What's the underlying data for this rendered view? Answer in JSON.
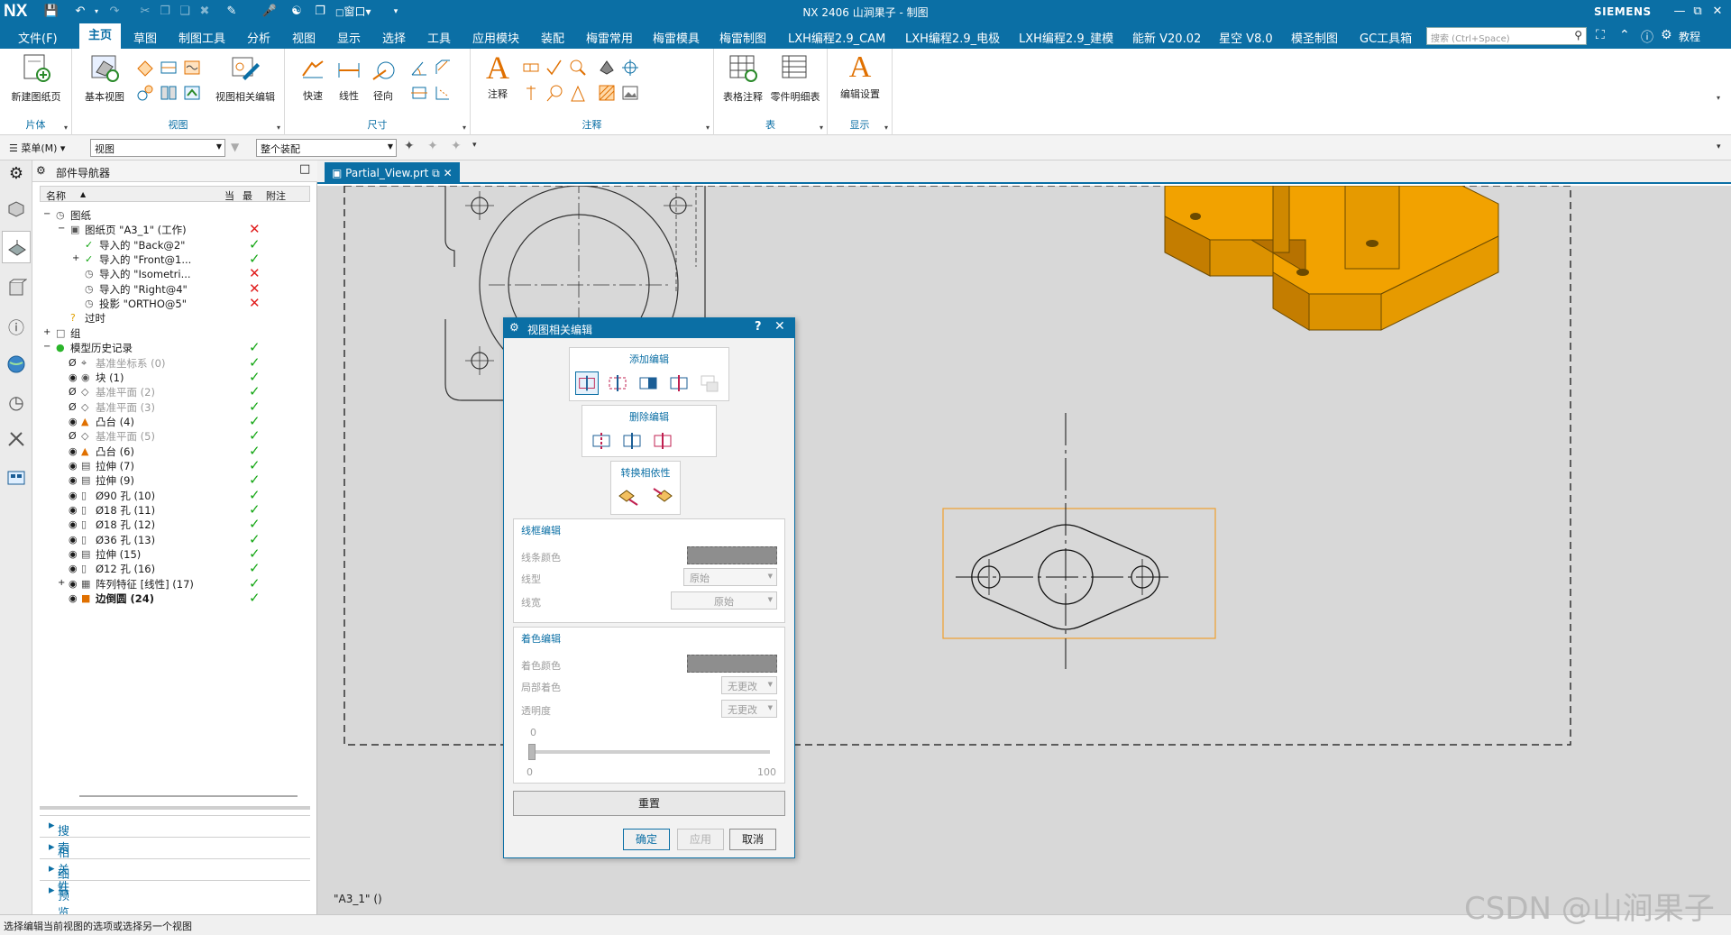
{
  "titlebar": {
    "logo": "NX",
    "title": "NX 2406 山涧果子 - 制图",
    "brand": "SIEMENS",
    "window_menu": "窗口"
  },
  "menubar": {
    "items": [
      "文件(F)",
      "主页",
      "草图",
      "制图工具",
      "分析",
      "视图",
      "显示",
      "选择",
      "工具",
      "应用模块",
      "装配",
      "梅雷常用",
      "梅雷模具",
      "梅雷制图",
      "LXH编程2.9_CAM",
      "LXH编程2.9_电极",
      "LXH编程2.9_建模",
      "能新 V20.02",
      "星空 V8.0",
      "模圣制图",
      "GC工具箱"
    ],
    "active": "主页",
    "search_placeholder": "搜索 (Ctrl+Space)",
    "tutorial": "教程"
  },
  "ribbon": {
    "groups": [
      {
        "label": "片体",
        "buttons": [
          "新建图纸页"
        ]
      },
      {
        "label": "视图",
        "buttons": [
          "基本视图",
          "视图相关编辑"
        ]
      },
      {
        "label": "尺寸",
        "buttons": [
          "快速",
          "线性",
          "径向"
        ]
      },
      {
        "label": "注释",
        "buttons": [
          "注释"
        ]
      },
      {
        "label": "表",
        "buttons": [
          "表格注释",
          "零件明细表"
        ]
      },
      {
        "label": "显示",
        "buttons": [
          "编辑设置"
        ]
      }
    ]
  },
  "cmdbar": {
    "menu": "菜单(M)",
    "filter": "视图",
    "scope": "整个装配"
  },
  "navigator": {
    "title": "部件导航器",
    "columns": [
      "名称",
      "当",
      "最",
      "附注"
    ],
    "rows": [
      {
        "label": "图纸",
        "mark": ""
      },
      {
        "label": "图纸页 \"A3_1\" (工作)",
        "mark": "x"
      },
      {
        "label": "导入的 \"Back@2\"",
        "mark": "v"
      },
      {
        "label": "导入的 \"Front@1...",
        "mark": "v"
      },
      {
        "label": "导入的 \"Isometri...",
        "mark": "x"
      },
      {
        "label": "导入的 \"Right@4\"",
        "mark": "x"
      },
      {
        "label": "投影 \"ORTHO@5\"",
        "mark": "x"
      },
      {
        "label": "过时",
        "mark": ""
      },
      {
        "label": "组",
        "mark": ""
      },
      {
        "label": "模型历史记录",
        "mark": "v"
      },
      {
        "label": "基准坐标系 (0)",
        "mark": "v"
      },
      {
        "label": "块 (1)",
        "mark": "v"
      },
      {
        "label": "基准平面 (2)",
        "mark": "v"
      },
      {
        "label": "基准平面 (3)",
        "mark": "v"
      },
      {
        "label": "凸台 (4)",
        "mark": "v"
      },
      {
        "label": "基准平面 (5)",
        "mark": "v"
      },
      {
        "label": "凸台 (6)",
        "mark": "v"
      },
      {
        "label": "拉伸 (7)",
        "mark": "v"
      },
      {
        "label": "拉伸 (9)",
        "mark": "v"
      },
      {
        "label": "Ø90 孔 (10)",
        "mark": "v"
      },
      {
        "label": "Ø18 孔 (11)",
        "mark": "v"
      },
      {
        "label": "Ø18 孔 (12)",
        "mark": "v"
      },
      {
        "label": "Ø36 孔 (13)",
        "mark": "v"
      },
      {
        "label": "拉伸 (15)",
        "mark": "v"
      },
      {
        "label": "Ø12 孔 (16)",
        "mark": "v"
      },
      {
        "label": "阵列特征 [线性] (17)",
        "mark": "v"
      },
      {
        "label": "边倒圆 (24)",
        "mark": "v"
      }
    ],
    "sections": [
      "搜索",
      "相关性",
      "细节",
      "预览"
    ]
  },
  "tab": {
    "label": "Partial_View.prt"
  },
  "sheet_label": "\"A3_1\" ()",
  "dialog": {
    "title": "视图相关编辑",
    "add_edit": "添加编辑",
    "delete_edit": "删除编辑",
    "convert": "转换相依性",
    "wire_edit": "线框编辑",
    "line_color": "线条颜色",
    "line_type": "线型",
    "line_type_value": "原始",
    "line_width": "线宽",
    "line_width_value": "原始",
    "shade_edit": "着色编辑",
    "shade_color": "着色颜色",
    "local_shade": "局部着色",
    "local_shade_value": "无更改",
    "transparency": "透明度",
    "transparency_value": "无更改",
    "slider_min": "0",
    "slider_max": "100",
    "slider_current": "0",
    "reset": "重置",
    "ok": "确定",
    "apply": "应用",
    "cancel": "取消"
  },
  "status": "选择编辑当前视图的选项或选择另一个视图",
  "watermark": "CSDN @山涧果子",
  "colors": {
    "brand_blue": "#0b6fa5",
    "model_orange": "#f2a200",
    "selection_orange": "#f0a030"
  }
}
